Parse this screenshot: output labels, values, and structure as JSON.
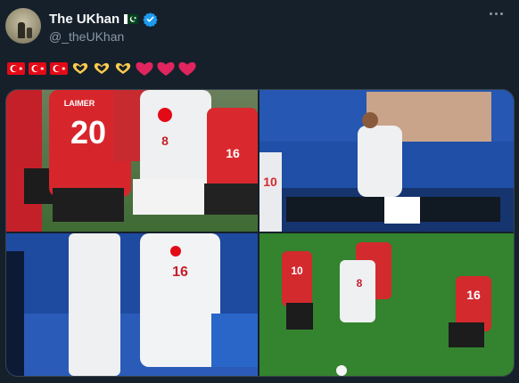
{
  "tweet": {
    "display_name": "The UKhan",
    "handle": "@_theUKhan",
    "name_flag_icon": "pakistan-flag-icon",
    "verified_icon": "verified-badge-icon",
    "more_icon": "more-options-icon",
    "emojis": [
      "turkey-flag-icon",
      "turkey-flag-icon",
      "turkey-flag-icon",
      "heart-hands-icon",
      "heart-hands-icon",
      "heart-hands-icon",
      "red-heart-icon",
      "red-heart-icon",
      "red-heart-icon"
    ],
    "media": {
      "photos": [
        {
          "name": "photo-1",
          "jersey_numbers": [
            "20",
            "8",
            "16"
          ],
          "jersey_text": "LAIMER"
        },
        {
          "name": "photo-2",
          "jersey_numbers": [
            "10"
          ]
        },
        {
          "name": "photo-3",
          "jersey_numbers": [
            "16"
          ]
        },
        {
          "name": "photo-4",
          "jersey_numbers": [
            "10",
            "8",
            "16"
          ]
        }
      ]
    }
  },
  "colors": {
    "background": "#15202b",
    "verified_blue": "#1d9bf0",
    "turkey_red": "#e30a17",
    "austria_red": "#d52b2b",
    "heart_red": "#e0245e",
    "heart_hands_yellow": "#ffcc4d"
  }
}
